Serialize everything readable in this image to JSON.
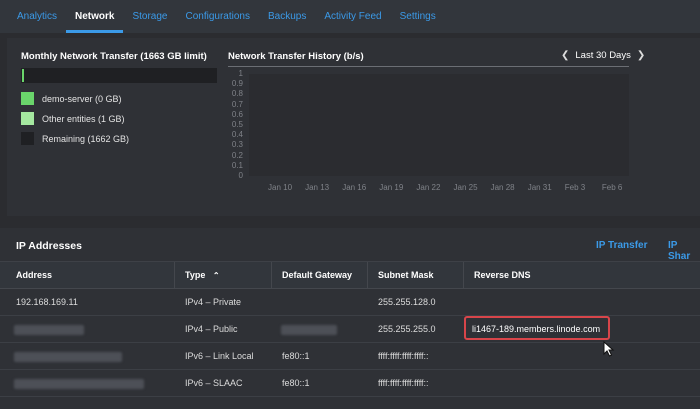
{
  "tabs": [
    {
      "label": "Analytics",
      "active": false
    },
    {
      "label": "Network",
      "active": true
    },
    {
      "label": "Storage",
      "active": false
    },
    {
      "label": "Configurations",
      "active": false
    },
    {
      "label": "Backups",
      "active": false
    },
    {
      "label": "Activity Feed",
      "active": false
    },
    {
      "label": "Settings",
      "active": false
    }
  ],
  "transfer": {
    "title": "Monthly Network Transfer (1663 GB limit)",
    "usage_fraction": 0.0006,
    "legend": [
      {
        "label": "demo-server (0 GB)",
        "color": "#6ad56b"
      },
      {
        "label": "Other entities (1 GB)",
        "color": "#a5e8a0"
      },
      {
        "label": "Remaining (1662 GB)",
        "color": "#1f2023"
      }
    ]
  },
  "history": {
    "title": "Network Transfer History (b/s)",
    "period": "Last 30 Days",
    "prev_icon": "chevron-left-icon",
    "next_icon": "chevron-right-icon"
  },
  "chart_data": {
    "type": "line",
    "title": "Network Transfer History (b/s)",
    "ylim": [
      0,
      1
    ],
    "yticks": [
      "1",
      "0.9",
      "0.8",
      "0.7",
      "0.6",
      "0.5",
      "0.4",
      "0.3",
      "0.2",
      "0.1",
      "0"
    ],
    "xticks": [
      "Jan 10",
      "Jan 13",
      "Jan 16",
      "Jan 19",
      "Jan 22",
      "Jan 25",
      "Jan 28",
      "Jan 31",
      "Feb 3",
      "Feb 6"
    ],
    "series": []
  },
  "ip": {
    "title": "IP Addresses",
    "actions": [
      "IP Transfer",
      "IP Shar"
    ],
    "columns": [
      "Address",
      "Type",
      "Default Gateway",
      "Subnet Mask",
      "Reverse DNS"
    ],
    "sort_icon": "chevron-up-icon",
    "rows": [
      {
        "address": "192.168.169.11",
        "type": "IPv4 – Private",
        "gateway": "",
        "mask": "255.255.128.0",
        "rdns": ""
      },
      {
        "address": "",
        "type": "IPv4 – Public",
        "gateway": "",
        "mask": "255.255.255.0",
        "rdns": "li1467-189.members.linode.com"
      },
      {
        "address": "",
        "type": "IPv6 – Link Local",
        "gateway": "fe80::1",
        "mask": "ffff:ffff:ffff:ffff::",
        "rdns": ""
      },
      {
        "address": "",
        "type": "IPv6 – SLAAC",
        "gateway": "fe80::1",
        "mask": "ffff:ffff:ffff:ffff::",
        "rdns": ""
      }
    ]
  }
}
